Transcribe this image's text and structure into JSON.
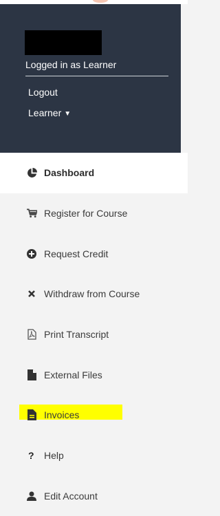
{
  "header": {
    "logged_in_text": "Logged in as Learner",
    "logout_label": "Logout",
    "role_label": "Learner"
  },
  "menu": {
    "items": [
      {
        "label": "Dashboard",
        "icon": "pie-chart-icon",
        "active": true
      },
      {
        "label": "Register for Course",
        "icon": "cart-icon"
      },
      {
        "label": "Request Credit",
        "icon": "plus-circle-icon"
      },
      {
        "label": "Withdraw from Course",
        "icon": "close-icon"
      },
      {
        "label": "Print Transcript",
        "icon": "pdf-icon"
      },
      {
        "label": "External Files",
        "icon": "file-icon"
      },
      {
        "label": "Invoices",
        "icon": "file-text-icon",
        "highlighted": true
      },
      {
        "label": "Help",
        "icon": "question-icon"
      },
      {
        "label": "Edit Account",
        "icon": "user-icon"
      }
    ]
  },
  "colors": {
    "header_bg": "#2c3544",
    "highlight": "#ffff00",
    "sidebar_bg": "#f3f3f3",
    "active_bg": "#ffffff"
  }
}
